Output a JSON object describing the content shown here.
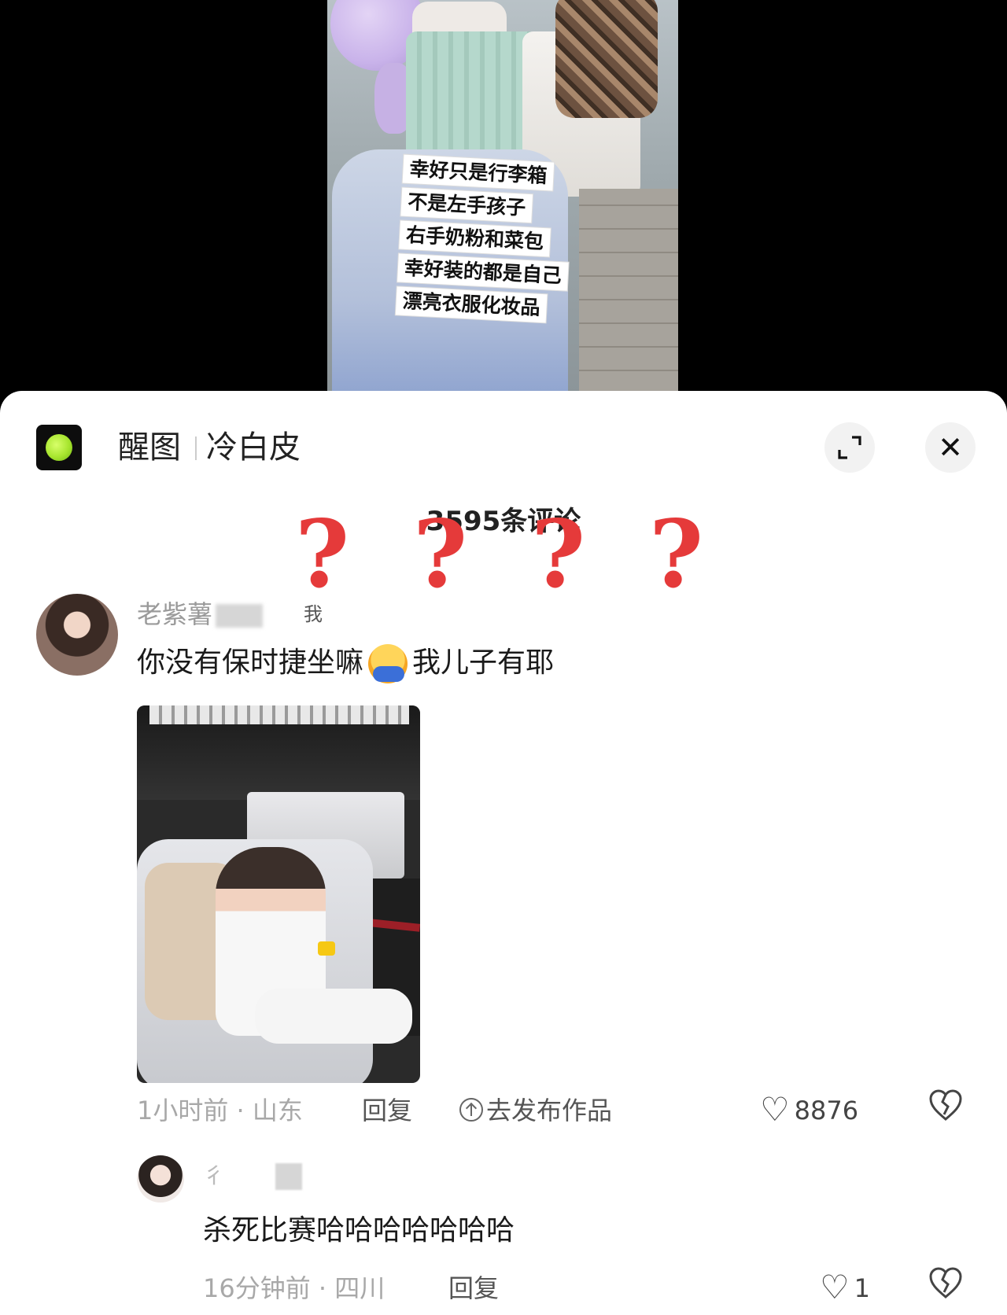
{
  "video": {
    "caption_lines": [
      "幸好只是行李箱",
      "不是左手孩子",
      "右手奶粉和菜包",
      "幸好装的都是自己",
      "漂亮衣服化妆品"
    ]
  },
  "header": {
    "title": "醒图",
    "subtitle": "冷白皮",
    "logo_icon": "app-logo-icon",
    "expand_icon": "expand-icon",
    "close_icon": "close-icon",
    "close_glyph": "✕"
  },
  "comments_header": {
    "count_label": "3595条评论"
  },
  "overlay": {
    "question_marks": [
      "?",
      "?",
      "?",
      "?"
    ],
    "color": "#e53a3a"
  },
  "comments": [
    {
      "username": "老紫薯",
      "author_tag": "我",
      "text_before_emoji": "你没有保时捷坐嘛",
      "emoji": "hugging-face-emoji",
      "text_after_emoji": "我儿子有耶",
      "meta": "1小时前 · 山东",
      "reply_label": "回复",
      "publish_label": "去发布作品",
      "likes": "8876",
      "like_icon": "heart-icon",
      "dislike_icon": "broken-heart-icon"
    },
    {
      "username": "彳",
      "text": "杀死比赛哈哈哈哈哈哈哈",
      "meta": "16分钟前 · 四川",
      "reply_label": "回复",
      "likes": "1",
      "like_icon": "heart-icon",
      "dislike_icon": "broken-heart-icon"
    }
  ]
}
